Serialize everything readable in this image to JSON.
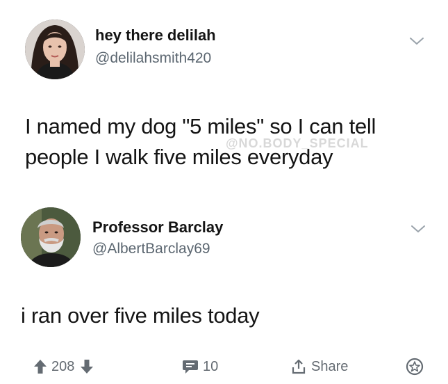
{
  "tweets": [
    {
      "display_name": "hey there delilah",
      "handle": "@delilahsmith420",
      "text": "I named my dog \"5 miles\" so I can tell people I walk five miles everyday",
      "watermark": "@NO.BODY_SPECIAL"
    },
    {
      "display_name": "Professor Barclay",
      "handle": "@AlbertBarclay69",
      "text": "i ran over five miles today"
    }
  ],
  "actions": {
    "vote_count": "208",
    "comment_count": "10",
    "share_label": "Share"
  },
  "colors": {
    "text": "#141414",
    "muted": "#5b6670",
    "icon": "#646b72"
  }
}
